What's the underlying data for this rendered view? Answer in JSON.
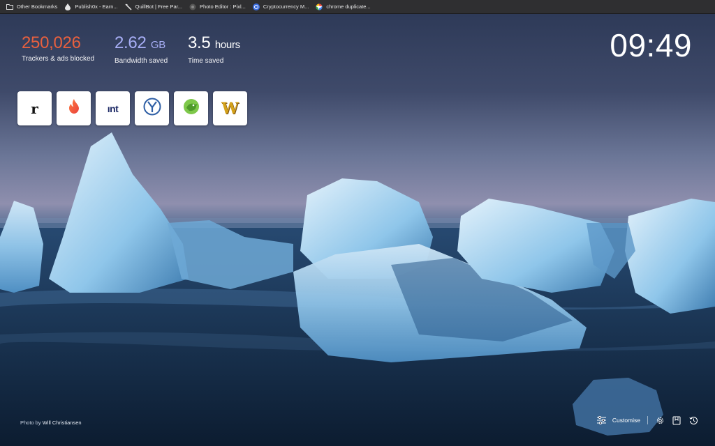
{
  "bookmarks": [
    {
      "label": "Other Bookmarks",
      "icon": "folder-icon"
    },
    {
      "label": "Publish0x - Earn...",
      "icon": "drop-icon"
    },
    {
      "label": "QuillBot | Free Par...",
      "icon": "quill-icon"
    },
    {
      "label": "Photo Editor : Pixl...",
      "icon": "pixlr-icon"
    },
    {
      "label": "Cryptocurrency M...",
      "icon": "coin-icon"
    },
    {
      "label": "chrome duplicate...",
      "icon": "google-icon"
    }
  ],
  "stats": {
    "trackers": {
      "value": "250,026",
      "label": "Trackers & ads blocked",
      "color": "#e8603e"
    },
    "bandwidth": {
      "value": "2.62",
      "unit": "GB",
      "label": "Bandwidth saved",
      "color": "#a7aef5"
    },
    "time": {
      "value": "3.5",
      "unit": "hours",
      "label": "Time saved",
      "color": "#ffffff"
    }
  },
  "clock": "09:49",
  "tiles": [
    {
      "name": "tile-r",
      "glyph": "r"
    },
    {
      "name": "tile-tinder",
      "glyph": ""
    },
    {
      "name": "tile-int",
      "glyph": "ınt"
    },
    {
      "name": "tile-y",
      "glyph": ""
    },
    {
      "name": "tile-bird",
      "glyph": ""
    },
    {
      "name": "tile-w",
      "glyph": "W"
    }
  ],
  "credit": {
    "prefix": "Photo by",
    "author": "Will Christiansen"
  },
  "footer": {
    "customise": "Customise"
  }
}
